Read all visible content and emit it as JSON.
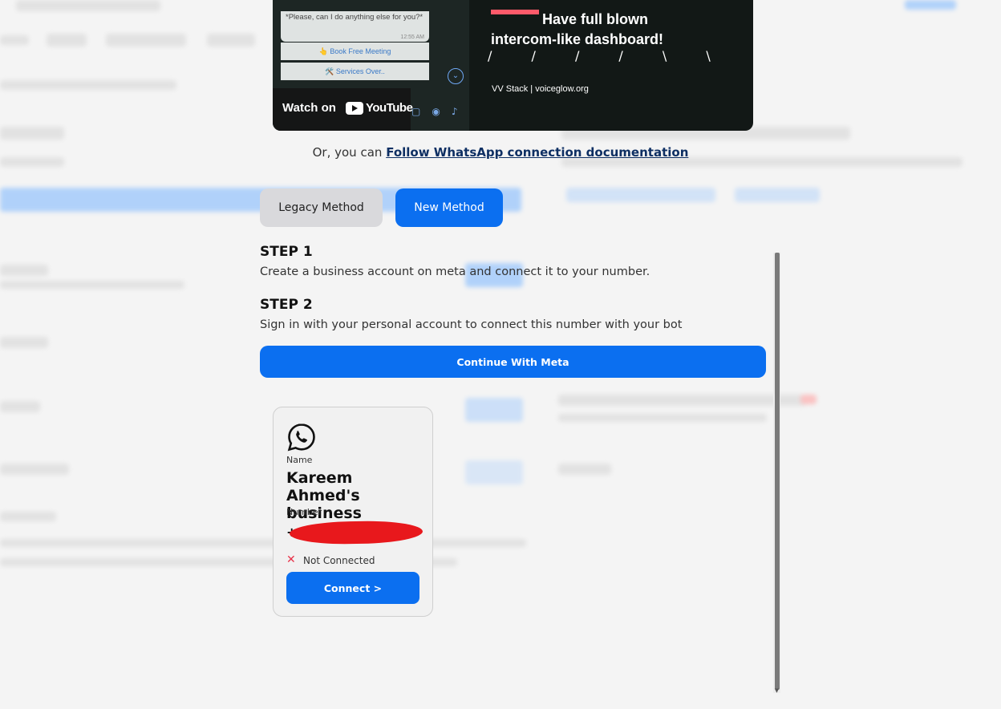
{
  "video": {
    "chat_message": "*Please, can I do anything else for you?*",
    "chat_time": "12:55 AM",
    "reply_1": "👆 Book Free Meeting",
    "reply_2": "🛠️ Services Over..",
    "watch_label": "Watch on",
    "youtube_label": "YouTube",
    "headline_line1": "Have full blown",
    "headline_line2": "intercom-like dashboard!",
    "byline": "VV Stack | voiceglow.org"
  },
  "follow": {
    "prefix": "Or, you can",
    "link": "Follow WhatsApp connection documentation"
  },
  "methods": {
    "legacy": "Legacy Method",
    "new": "New Method"
  },
  "steps": [
    {
      "title": "STEP 1",
      "desc": "Create a business account on meta and connect it to your number."
    },
    {
      "title": "STEP 2",
      "desc": "Sign in with your personal account to connect this number with your bot"
    }
  ],
  "continue_button": "Continue With Meta",
  "card": {
    "icon": "whatsapp-icon",
    "name_label": "Name",
    "name_value": "Kareem Ahmed's business",
    "number_label": "Number",
    "status": "Not Connected",
    "connect_button": "Connect >"
  },
  "colors": {
    "primary": "#0b6ff0",
    "link": "#0e2f63",
    "error": "#e8334a",
    "redaction": "#e8181c"
  }
}
